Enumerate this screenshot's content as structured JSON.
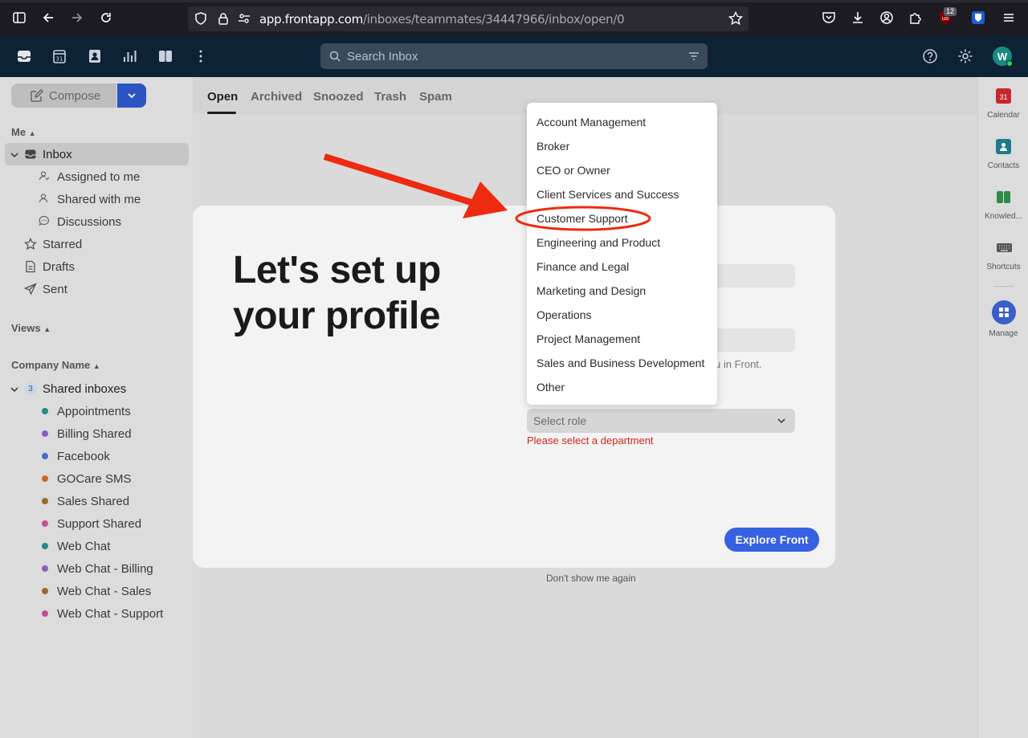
{
  "browser": {
    "url_host": "app.frontapp.com",
    "url_path": "/inboxes/teammates/34447966/inbox/open/0",
    "notification_count": "12"
  },
  "header": {
    "search_placeholder": "Search Inbox",
    "avatar_letter": "W"
  },
  "sidebar": {
    "compose_label": "Compose",
    "me_heading": "Me",
    "inbox_label": "Inbox",
    "inbox_subitems": [
      "Assigned to me",
      "Shared with me",
      "Discussions"
    ],
    "starred": "Starred",
    "drafts": "Drafts",
    "sent": "Sent",
    "views_heading": "Views",
    "company_heading": "Company Name",
    "shared_inboxes_label": "Shared inboxes",
    "shared_inboxes_count": "3",
    "shared_inboxes": [
      {
        "name": "Appointments",
        "color": "#1f8a8a"
      },
      {
        "name": "Billing Shared",
        "color": "#8a5cc6"
      },
      {
        "name": "Facebook",
        "color": "#4a6bd0"
      },
      {
        "name": "GOCare SMS",
        "color": "#d4622a"
      },
      {
        "name": "Sales Shared",
        "color": "#9b6a22"
      },
      {
        "name": "Support Shared",
        "color": "#c94a9a"
      },
      {
        "name": "Web Chat",
        "color": "#1f8a8a"
      },
      {
        "name": "Web Chat - Billing",
        "color": "#8a5cc6"
      },
      {
        "name": "Web Chat - Sales",
        "color": "#9b6a22"
      },
      {
        "name": "Web Chat - Support",
        "color": "#c94a9a"
      }
    ]
  },
  "tabs": [
    "Open",
    "Archived",
    "Snoozed",
    "Trash",
    "Spam"
  ],
  "rail": {
    "items": [
      "Calendar",
      "Contacts",
      "Knowled...",
      "Shortcuts",
      "Manage"
    ],
    "calendar_day": "31"
  },
  "modal": {
    "title": "Let's set up your profile",
    "hint_text": "u in Front.",
    "select_placeholder": "Select role",
    "error": "Please select a department",
    "explore_button": "Explore Front",
    "dont_show": "Don't show me again"
  },
  "dropdown": {
    "options": [
      "Account Management",
      "Broker",
      "CEO or Owner",
      "Client Services and Success",
      "Customer Support",
      "Engineering and Product",
      "Finance and Legal",
      "Marketing and Design",
      "Operations",
      "Project Management",
      "Sales and Business Development",
      "Other"
    ],
    "highlighted": "Customer Support"
  },
  "annotation_color": "#ee2a10"
}
